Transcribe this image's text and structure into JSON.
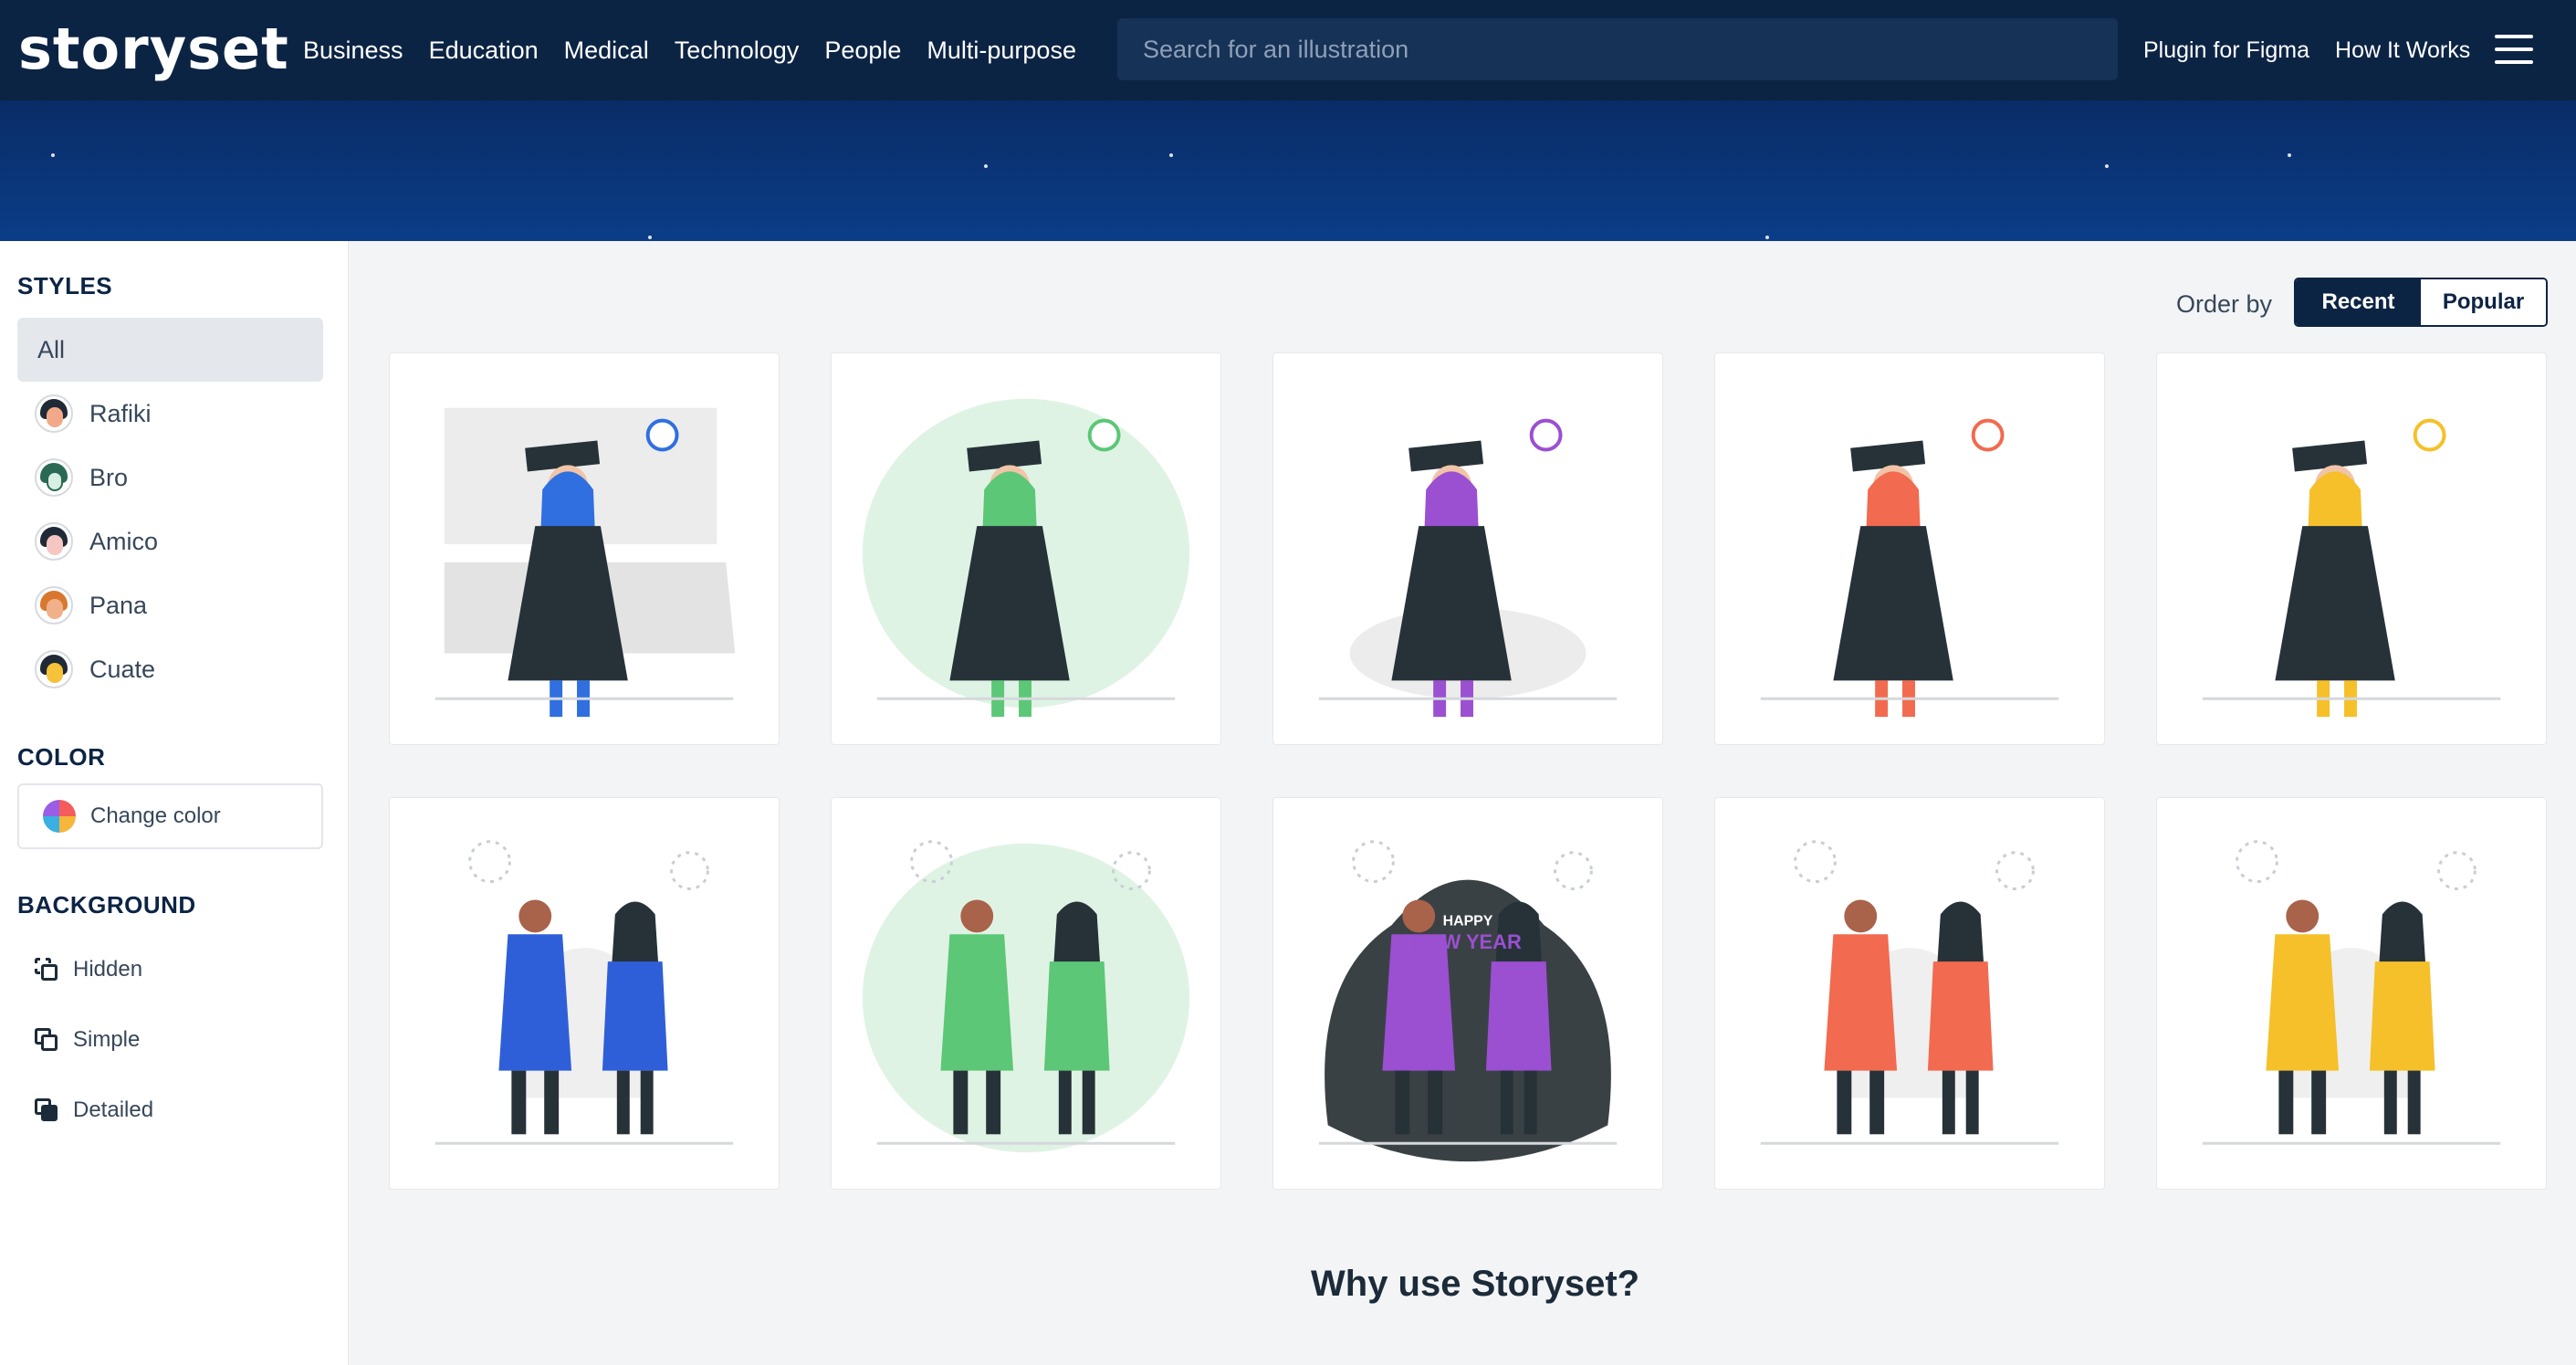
{
  "brand": {
    "logo_text": "storyset",
    "accent_color": "#2f7fff",
    "nav_bg": "#0c2444"
  },
  "nav": {
    "links": [
      "Business",
      "Education",
      "Medical",
      "Technology",
      "People",
      "Multi-purpose"
    ],
    "search_placeholder": "Search for an illustration",
    "right_links": [
      "Plugin for Figma",
      "How It Works"
    ],
    "menu_icon": "hamburger-icon"
  },
  "sidebar": {
    "styles_heading": "STYLES",
    "styles": [
      {
        "label": "All",
        "selected": true
      },
      {
        "label": "Rafiki",
        "icon": "rafiki-avatar-icon"
      },
      {
        "label": "Bro",
        "icon": "bro-avatar-icon"
      },
      {
        "label": "Amico",
        "icon": "amico-avatar-icon"
      },
      {
        "label": "Pana",
        "icon": "pana-avatar-icon"
      },
      {
        "label": "Cuate",
        "icon": "cuate-avatar-icon"
      }
    ],
    "color_heading": "COLOR",
    "change_color_label": "Change color",
    "background_heading": "BACKGROUND",
    "backgrounds": [
      {
        "label": "Hidden",
        "icon": "background-hidden-icon"
      },
      {
        "label": "Simple",
        "icon": "background-simple-icon"
      },
      {
        "label": "Detailed",
        "icon": "background-detailed-icon"
      }
    ]
  },
  "main": {
    "order_label": "Order by",
    "order_options": [
      {
        "label": "Recent",
        "active": true
      },
      {
        "label": "Popular",
        "active": false
      }
    ],
    "illustrations": [
      {
        "name": "graduation-hijab-university",
        "accent": "#2f6fe0"
      },
      {
        "name": "graduation-jump-celebration",
        "accent": "#5cc777"
      },
      {
        "name": "graduation-flowers",
        "accent": "#9b4fd1"
      },
      {
        "name": "graduation-diploma",
        "accent": "#f26a4f"
      },
      {
        "name": "graduation-heart",
        "accent": "#f5c02a"
      },
      {
        "name": "ramadan-couple-blue",
        "accent": "#2f5fd8"
      },
      {
        "name": "ramadan-night-green",
        "accent": "#5cc777"
      },
      {
        "name": "happy-new-year-family",
        "accent": "#9b4fd1",
        "banner_line1": "HAPPY",
        "banner_line2": "NEW YEAR"
      },
      {
        "name": "ramadan-couple-red",
        "accent": "#f26a4f"
      },
      {
        "name": "ramadan-couple-yellow",
        "accent": "#f5c02a"
      }
    ],
    "why_heading": "Why use Storyset?"
  }
}
